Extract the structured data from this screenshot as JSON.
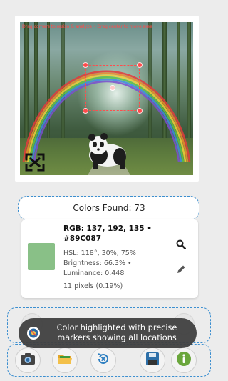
{
  "image_panel": {
    "hint": "Drag corners to resize & analyze • Drag center to move area",
    "crop_icon": "fullscreen-crop-icon"
  },
  "colors_found": {
    "label": "Colors Found: 73"
  },
  "color_info": {
    "rgb": "RGB: 137, 192, 135 • #89C087",
    "hsl": "HSL: 118°, 30%, 75%",
    "brightness": "Brightness: 66.3% •",
    "luminance": "Luminance: 0.448",
    "pixels": "11 pixels (0.19%)",
    "swatch_color": "#89C087",
    "icons": [
      "magnifier-icon",
      "pencil-icon"
    ]
  },
  "toast": {
    "message": "Color highlighted with precise markers showing all locations"
  },
  "toolbar": {
    "buttons": [
      {
        "name": "camera",
        "icon": "camera-icon"
      },
      {
        "name": "folder",
        "icon": "folder-icon"
      },
      {
        "name": "reset",
        "icon": "reset-icon"
      },
      {
        "name": "save",
        "icon": "save-icon"
      },
      {
        "name": "info",
        "icon": "info-icon"
      }
    ]
  },
  "colors": {
    "accent_dash": "#3C8FD0",
    "marker": "#FF4B4B",
    "toast_bg": "#404040"
  }
}
